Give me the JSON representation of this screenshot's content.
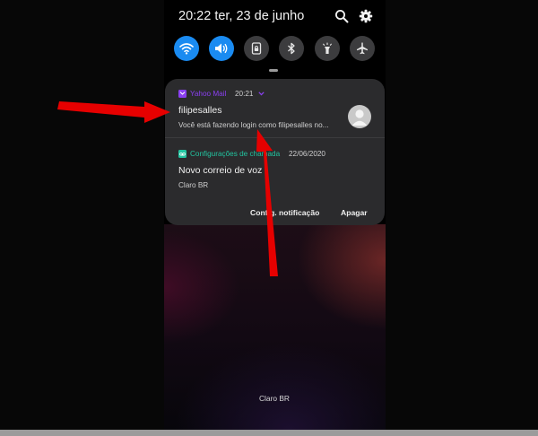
{
  "status": {
    "time_date": "20:22  ter, 23 de junho"
  },
  "toolbar": {
    "search_icon": "search-icon",
    "settings_icon": "gear-icon"
  },
  "quick_settings": [
    {
      "icon": "wifi-icon",
      "state": "on"
    },
    {
      "icon": "volume-icon",
      "state": "on"
    },
    {
      "icon": "screen-lock-icon",
      "state": "off"
    },
    {
      "icon": "bluetooth-icon",
      "state": "off"
    },
    {
      "icon": "flashlight-icon",
      "state": "off"
    },
    {
      "icon": "airplane-icon",
      "state": "off"
    }
  ],
  "notifications": [
    {
      "app": "Yahoo Mail",
      "time": "20:21",
      "title": "filipesalles",
      "body": "Você está fazendo login como filipesalles no..."
    },
    {
      "app": "Configurações de chamada",
      "time": "22/06/2020",
      "title": "Novo correio de voz",
      "body": "Claro BR"
    }
  ],
  "actions": {
    "settings": "Config. notificação",
    "clear": "Apagar"
  },
  "carrier": "Claro BR",
  "colors": {
    "accent_blue": "#1a8bf1",
    "yahoo_purple": "#8a3ff0",
    "call_teal": "#22c4a0",
    "arrow_red": "#e60000",
    "panel": "#2b2b2d"
  }
}
